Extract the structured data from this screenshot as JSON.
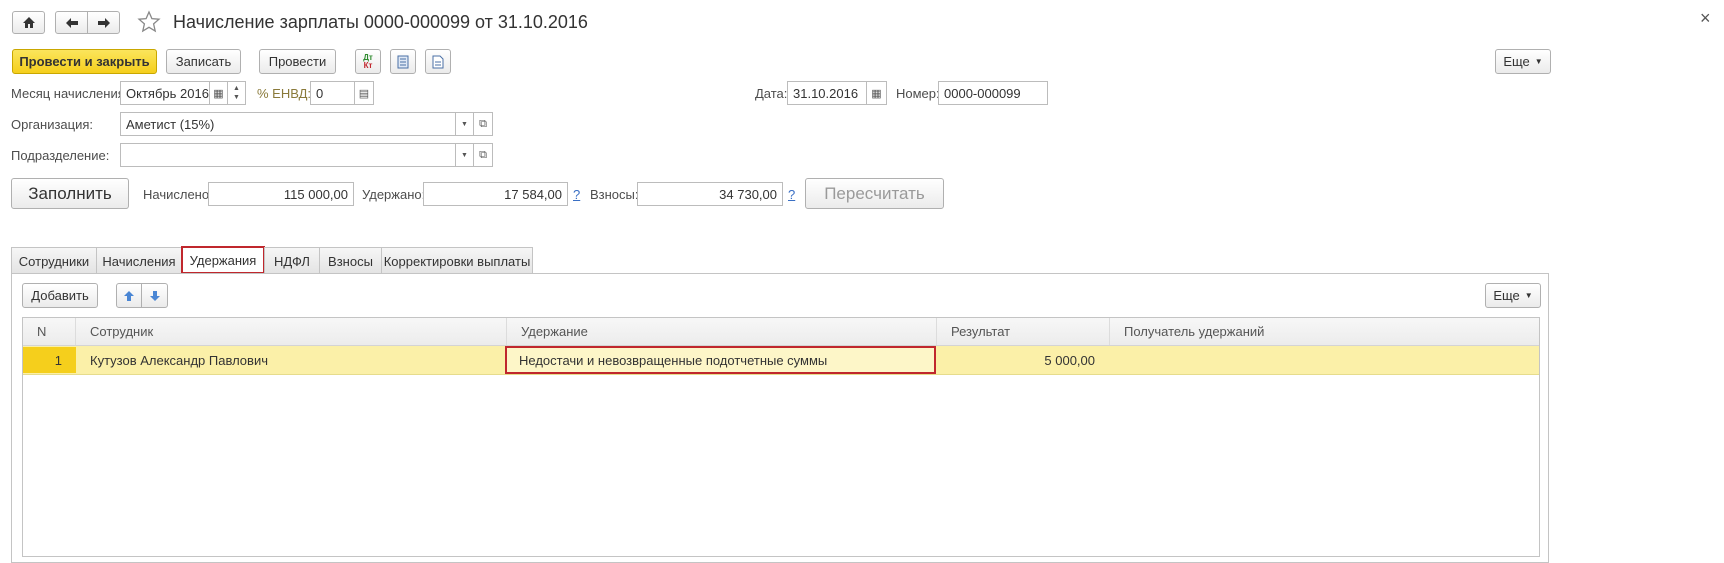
{
  "window": {
    "title": "Начисление зарплаты 0000-000099 от 31.10.2016",
    "close_glyph": "×"
  },
  "toolbar": {
    "post_close_label": "Провести и закрыть",
    "save_label": "Записать",
    "post_label": "Провести",
    "more_label": "Еще",
    "dt_kt_label_top": "Дт",
    "dt_kt_label_bottom": "Кт"
  },
  "header": {
    "month_label": "Месяц начисления:",
    "month_value": "Октябрь 2016",
    "envd_label": "% ЕНВД:",
    "envd_value": "0",
    "date_label": "Дата:",
    "date_value": "31.10.2016",
    "number_label": "Номер:",
    "number_value": "0000-000099",
    "org_label": "Организация:",
    "org_value": "Аметист (15%)",
    "dept_label": "Подразделение:",
    "dept_value": ""
  },
  "totals": {
    "fill_label": "Заполнить",
    "accrued_label": "Начислено:",
    "accrued_value": "115 000,00",
    "withheld_label": "Удержано:",
    "withheld_value": "17 584,00",
    "contrib_label": "Взносы:",
    "contrib_value": "34 730,00",
    "help_mark": "?",
    "recalc_label": "Пересчитать"
  },
  "tabs": [
    {
      "label": "Сотрудники"
    },
    {
      "label": "Начисления"
    },
    {
      "label": "Удержания"
    },
    {
      "label": "НДФЛ"
    },
    {
      "label": "Взносы"
    },
    {
      "label": "Корректировки выплаты"
    }
  ],
  "table_toolbar": {
    "add_label": "Добавить",
    "more_label": "Еще"
  },
  "table": {
    "columns": [
      "N",
      "Сотрудник",
      "Удержание",
      "Результат",
      "Получатель удержаний"
    ],
    "rows": [
      {
        "n": "1",
        "employee": "Кутузов Александр Павлович",
        "deduction": "Недостачи и невозвращенные подотчетные суммы",
        "result": "5 000,00",
        "recipient": ""
      }
    ]
  },
  "colors": {
    "accent_yellow": "#f5cf1c",
    "selected_row": "#fbf0a8",
    "highlight_red": "#c0272d"
  }
}
